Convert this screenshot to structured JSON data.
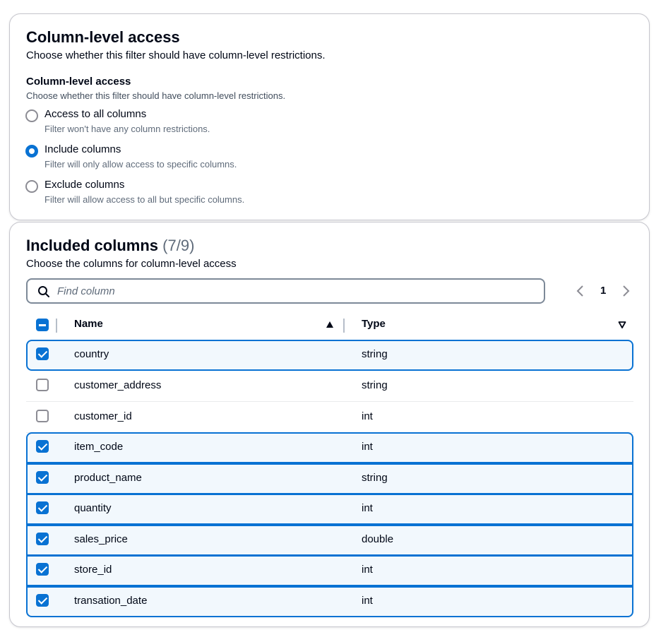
{
  "access_panel": {
    "title": "Column-level access",
    "description": "Choose whether this filter should have column-level restrictions.",
    "field_label": "Column-level access",
    "field_description": "Choose whether this filter should have column-level restrictions.",
    "options": [
      {
        "label": "Access to all columns",
        "description": "Filter won't have any column restrictions.",
        "checked": false
      },
      {
        "label": "Include columns",
        "description": "Filter will only allow access to specific columns.",
        "checked": true
      },
      {
        "label": "Exclude columns",
        "description": "Filter will allow access to all but specific columns.",
        "checked": false
      }
    ]
  },
  "columns_panel": {
    "title": "Included columns",
    "count": "(7/9)",
    "description": "Choose the columns for column-level access",
    "search": {
      "placeholder": "Find column",
      "value": ""
    },
    "pagination": {
      "current_page": "1"
    },
    "headers": {
      "name": "Name",
      "type": "Type"
    },
    "rows": [
      {
        "name": "country",
        "type": "string",
        "checked": true
      },
      {
        "name": "customer_address",
        "type": "string",
        "checked": false
      },
      {
        "name": "customer_id",
        "type": "int",
        "checked": false
      },
      {
        "name": "item_code",
        "type": "int",
        "checked": true
      },
      {
        "name": "product_name",
        "type": "string",
        "checked": true
      },
      {
        "name": "quantity",
        "type": "int",
        "checked": true
      },
      {
        "name": "sales_price",
        "type": "double",
        "checked": true
      },
      {
        "name": "store_id",
        "type": "int",
        "checked": true
      },
      {
        "name": "transation_date",
        "type": "int",
        "checked": true
      }
    ]
  },
  "colors": {
    "accent": "#0972d3",
    "selected_row_bg": "#f2f8fd",
    "border": "#c6c6cd",
    "text": "#000716",
    "secondary_text": "#5f6b7a"
  },
  "icons": {
    "search": "search-icon",
    "prev": "chevron-left-icon",
    "next": "chevron-right-icon",
    "sort_ascending": "caret-up-filled-icon",
    "sort_descending": "caret-down-icon"
  }
}
